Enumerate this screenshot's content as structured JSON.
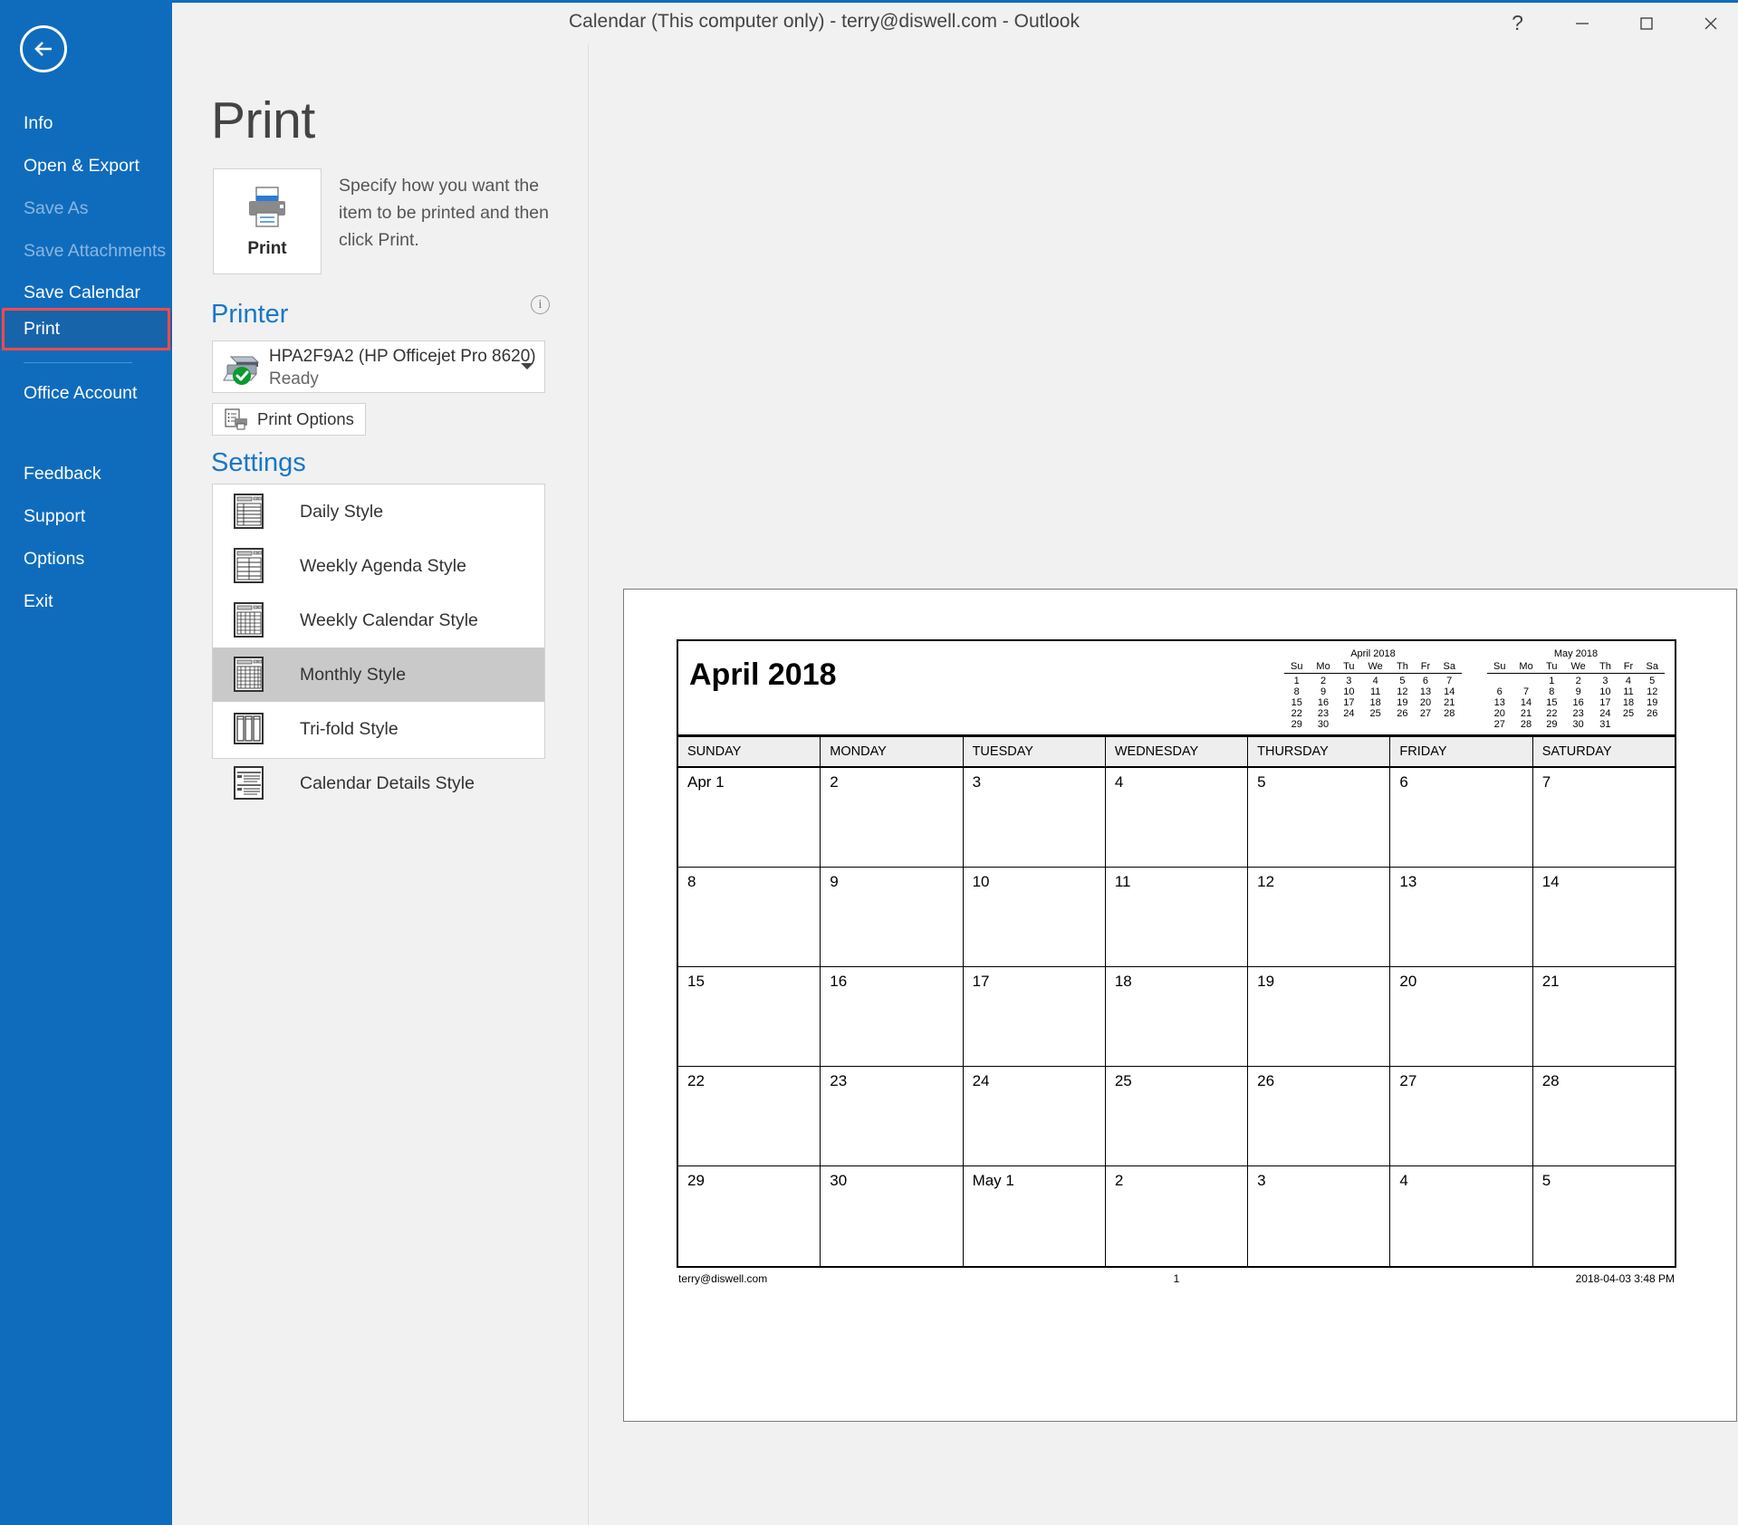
{
  "window": {
    "title": "Calendar (This computer only) - terry@diswell.com  -  Outlook",
    "help_label": "?",
    "minimize_label": "—",
    "maximize_label": "□",
    "close_label": "✕",
    "accent_color": "#0f6cbd"
  },
  "sidebar": {
    "back_label": "Back",
    "items": [
      {
        "label": "Info",
        "state": "normal"
      },
      {
        "label": "Open & Export",
        "state": "normal"
      },
      {
        "label": "Save As",
        "state": "disabled"
      },
      {
        "label": "Save Attachments",
        "state": "disabled"
      },
      {
        "label": "Save Calendar",
        "state": "normal"
      },
      {
        "label": "Print",
        "state": "selected"
      },
      {
        "label": "Office Account",
        "state": "normal"
      },
      {
        "label": "Feedback",
        "state": "normal"
      },
      {
        "label": "Support",
        "state": "normal"
      },
      {
        "label": "Options",
        "state": "normal"
      },
      {
        "label": "Exit",
        "state": "normal"
      }
    ],
    "highlight_color": "#fb4a4a"
  },
  "print_pane": {
    "heading": "Print",
    "print_button_label": "Print",
    "description": "Specify how you want the item to be printed and then click Print.",
    "printer_section_label": "Printer",
    "info_label": "i",
    "printer_name": "HPA2F9A2 (HP Officejet Pro 8620)",
    "printer_status": "Ready",
    "print_options_label": "Print Options",
    "settings_section_label": "Settings",
    "styles": [
      {
        "label": "Daily Style",
        "selected": false
      },
      {
        "label": "Weekly Agenda Style",
        "selected": false
      },
      {
        "label": "Weekly Calendar Style",
        "selected": false
      },
      {
        "label": "Monthly Style",
        "selected": true
      },
      {
        "label": "Tri-fold Style",
        "selected": false
      },
      {
        "label": "Calendar Details Style",
        "selected": false
      }
    ]
  },
  "preview": {
    "month_title": "April 2018",
    "mini_calendars": [
      {
        "title": "April 2018",
        "headers": [
          "Su",
          "Mo",
          "Tu",
          "We",
          "Th",
          "Fr",
          "Sa"
        ],
        "weeks": [
          [
            "1",
            "2",
            "3",
            "4",
            "5",
            "6",
            "7"
          ],
          [
            "8",
            "9",
            "10",
            "11",
            "12",
            "13",
            "14"
          ],
          [
            "15",
            "16",
            "17",
            "18",
            "19",
            "20",
            "21"
          ],
          [
            "22",
            "23",
            "24",
            "25",
            "26",
            "27",
            "28"
          ],
          [
            "29",
            "30",
            "",
            "",
            "",
            "",
            ""
          ]
        ]
      },
      {
        "title": "May 2018",
        "headers": [
          "Su",
          "Mo",
          "Tu",
          "We",
          "Th",
          "Fr",
          "Sa"
        ],
        "weeks": [
          [
            "",
            "",
            "1",
            "2",
            "3",
            "4",
            "5"
          ],
          [
            "6",
            "7",
            "8",
            "9",
            "10",
            "11",
            "12"
          ],
          [
            "13",
            "14",
            "15",
            "16",
            "17",
            "18",
            "19"
          ],
          [
            "20",
            "21",
            "22",
            "23",
            "24",
            "25",
            "26"
          ],
          [
            "27",
            "28",
            "29",
            "30",
            "31",
            "",
            ""
          ]
        ]
      }
    ],
    "day_headers": [
      "SUNDAY",
      "MONDAY",
      "TUESDAY",
      "WEDNESDAY",
      "THURSDAY",
      "FRIDAY",
      "SATURDAY"
    ],
    "weeks": [
      [
        "Apr 1",
        "2",
        "3",
        "4",
        "5",
        "6",
        "7"
      ],
      [
        "8",
        "9",
        "10",
        "11",
        "12",
        "13",
        "14"
      ],
      [
        "15",
        "16",
        "17",
        "18",
        "19",
        "20",
        "21"
      ],
      [
        "22",
        "23",
        "24",
        "25",
        "26",
        "27",
        "28"
      ],
      [
        "29",
        "30",
        "May 1",
        "2",
        "3",
        "4",
        "5"
      ]
    ],
    "footer_left": "terry@diswell.com",
    "footer_center": "1",
    "footer_right": "2018-04-03 3:48 PM"
  }
}
